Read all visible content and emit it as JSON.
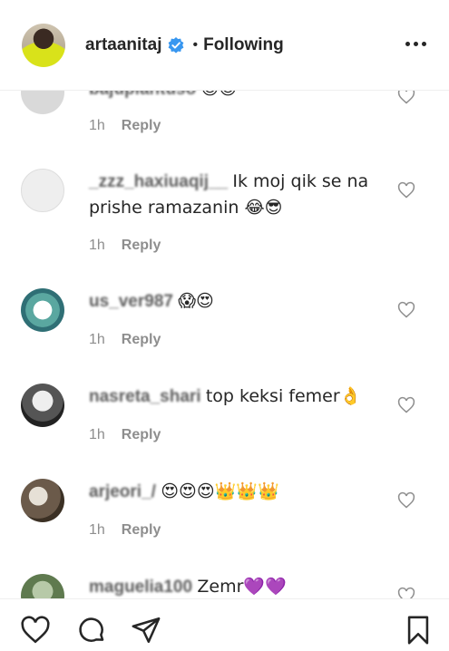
{
  "header": {
    "username": "artaanitaj",
    "separator": "•",
    "follow_status": "Following"
  },
  "comments": [
    {
      "username": "bajuplantuso",
      "text": "😍😍",
      "time": "1h",
      "reply": "Reply"
    },
    {
      "username": "_zzz_haxiuaqij__",
      "text": "Ik moj qik se na prishe ramazanin 😂😎",
      "time": "1h",
      "reply": "Reply"
    },
    {
      "username": "us_ver987",
      "text": "😱😍",
      "time": "1h",
      "reply": "Reply"
    },
    {
      "username": "nasreta_shari",
      "text": "top keksi femer👌",
      "time": "1h",
      "reply": "Reply"
    },
    {
      "username": "arjeori_/",
      "text": "😍😍😍👑👑👑",
      "time": "1h",
      "reply": "Reply"
    },
    {
      "username": "maguelia100",
      "text": "Zemr💜💜",
      "time": "",
      "reply": ""
    }
  ],
  "colors": {
    "text": "#262626",
    "meta": "#8e8e8e",
    "verified": "#3897f0",
    "divider": "#efefef"
  },
  "icons": {
    "like": "heart-icon",
    "comment": "comment-bubble-icon",
    "share": "paper-plane-icon",
    "save": "bookmark-icon",
    "more": "ellipsis-icon",
    "verified": "verified-badge-icon"
  }
}
